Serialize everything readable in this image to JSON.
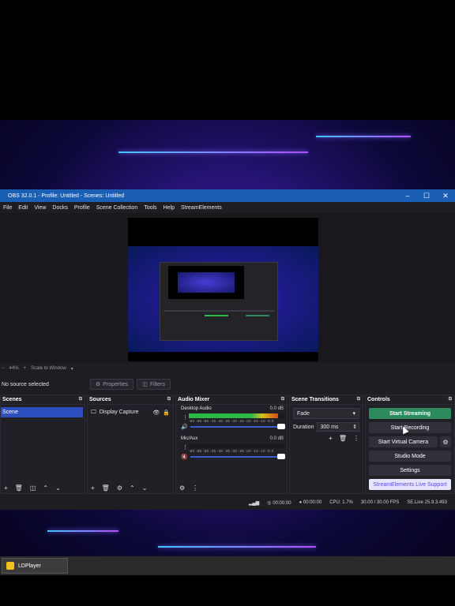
{
  "window": {
    "title": "OBS 32.0.1 - Profile: Untitled - Scenes: Untitled"
  },
  "menu": [
    "File",
    "Edit",
    "View",
    "Docks",
    "Profile",
    "Scene Collection",
    "Tools",
    "Help",
    "StreamElements"
  ],
  "preview": {
    "zoom": "44%",
    "scale_label": "Scale to Window"
  },
  "source_toolbar": {
    "no_source": "No source selected",
    "properties": "Properties",
    "filters": "Filters"
  },
  "scenes": {
    "title": "Scenes",
    "items": [
      "Scene"
    ]
  },
  "sources": {
    "title": "Sources",
    "items": [
      "Display Capture"
    ]
  },
  "mixer": {
    "title": "Audio Mixer",
    "channels": [
      {
        "name": "Desktop Audio",
        "db": "0.0 dB",
        "level": 0.93
      },
      {
        "name": "Mic/Aux",
        "db": "0.0 dB",
        "level": 0.0
      }
    ],
    "ticks": "-60 -55 -50 -45 -40 -35 -30 -25 -20 -15 -10 -5 0"
  },
  "transitions": {
    "title": "Scene Transitions",
    "selected": "Fade",
    "duration_label": "Duration",
    "duration_value": "300 ms"
  },
  "controls": {
    "title": "Controls",
    "start_streaming": "Start Streaming",
    "start_recording": "Start Recording",
    "start_virtual_camera": "Start Virtual Camera",
    "studio_mode": "Studio Mode",
    "settings": "Settings",
    "live_support": "StreamElements Live Support"
  },
  "status": {
    "stream_time": "00:00:00",
    "rec_time": "00:00:00",
    "cpu": "CPU: 1.7%",
    "fps": "30.00 / 30.00 FPS",
    "se_version": "SE.Live 25.9.3.493"
  },
  "taskbar": {
    "app": "LDPlayer"
  },
  "colors": {
    "accent": "#2d4fbf",
    "stream": "#2d8a5c",
    "titlebar": "#1a5fb4"
  }
}
